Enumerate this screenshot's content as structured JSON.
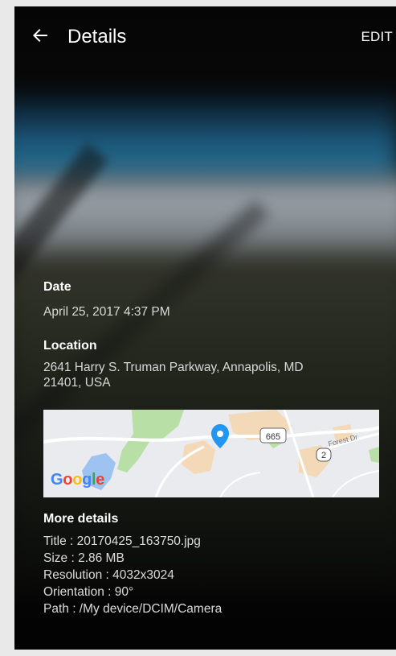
{
  "header": {
    "title": "Details",
    "edit_label": "EDIT"
  },
  "date": {
    "label": "Date",
    "value": "April 25, 2017 4:37 PM"
  },
  "location": {
    "label": "Location",
    "line1": "2641 Harry S. Truman Parkway, Annapolis, MD",
    "line2": "21401, USA"
  },
  "map": {
    "route_665": "665",
    "route_2": "2",
    "street": "Forest Dr",
    "logo": {
      "G": "G",
      "o1": "o",
      "o2": "o",
      "g": "g",
      "l": "l",
      "e": "e"
    }
  },
  "more_details": {
    "label": "More details",
    "title": "Title : 20170425_163750.jpg",
    "size": "Size : 2.86 MB",
    "resolution": "Resolution : 4032x3024",
    "orientation": "Orientation : 90°",
    "path": "Path : /My device/DCIM/Camera"
  },
  "icons": {
    "back": "arrow-left-icon",
    "pin": "map-pin-icon"
  },
  "colors": {
    "pin": "#2196f3",
    "map_bg": "#e9ebee",
    "park": "#b8dfa5",
    "water": "#9fc3f0",
    "urban": "#f3d9b8"
  }
}
